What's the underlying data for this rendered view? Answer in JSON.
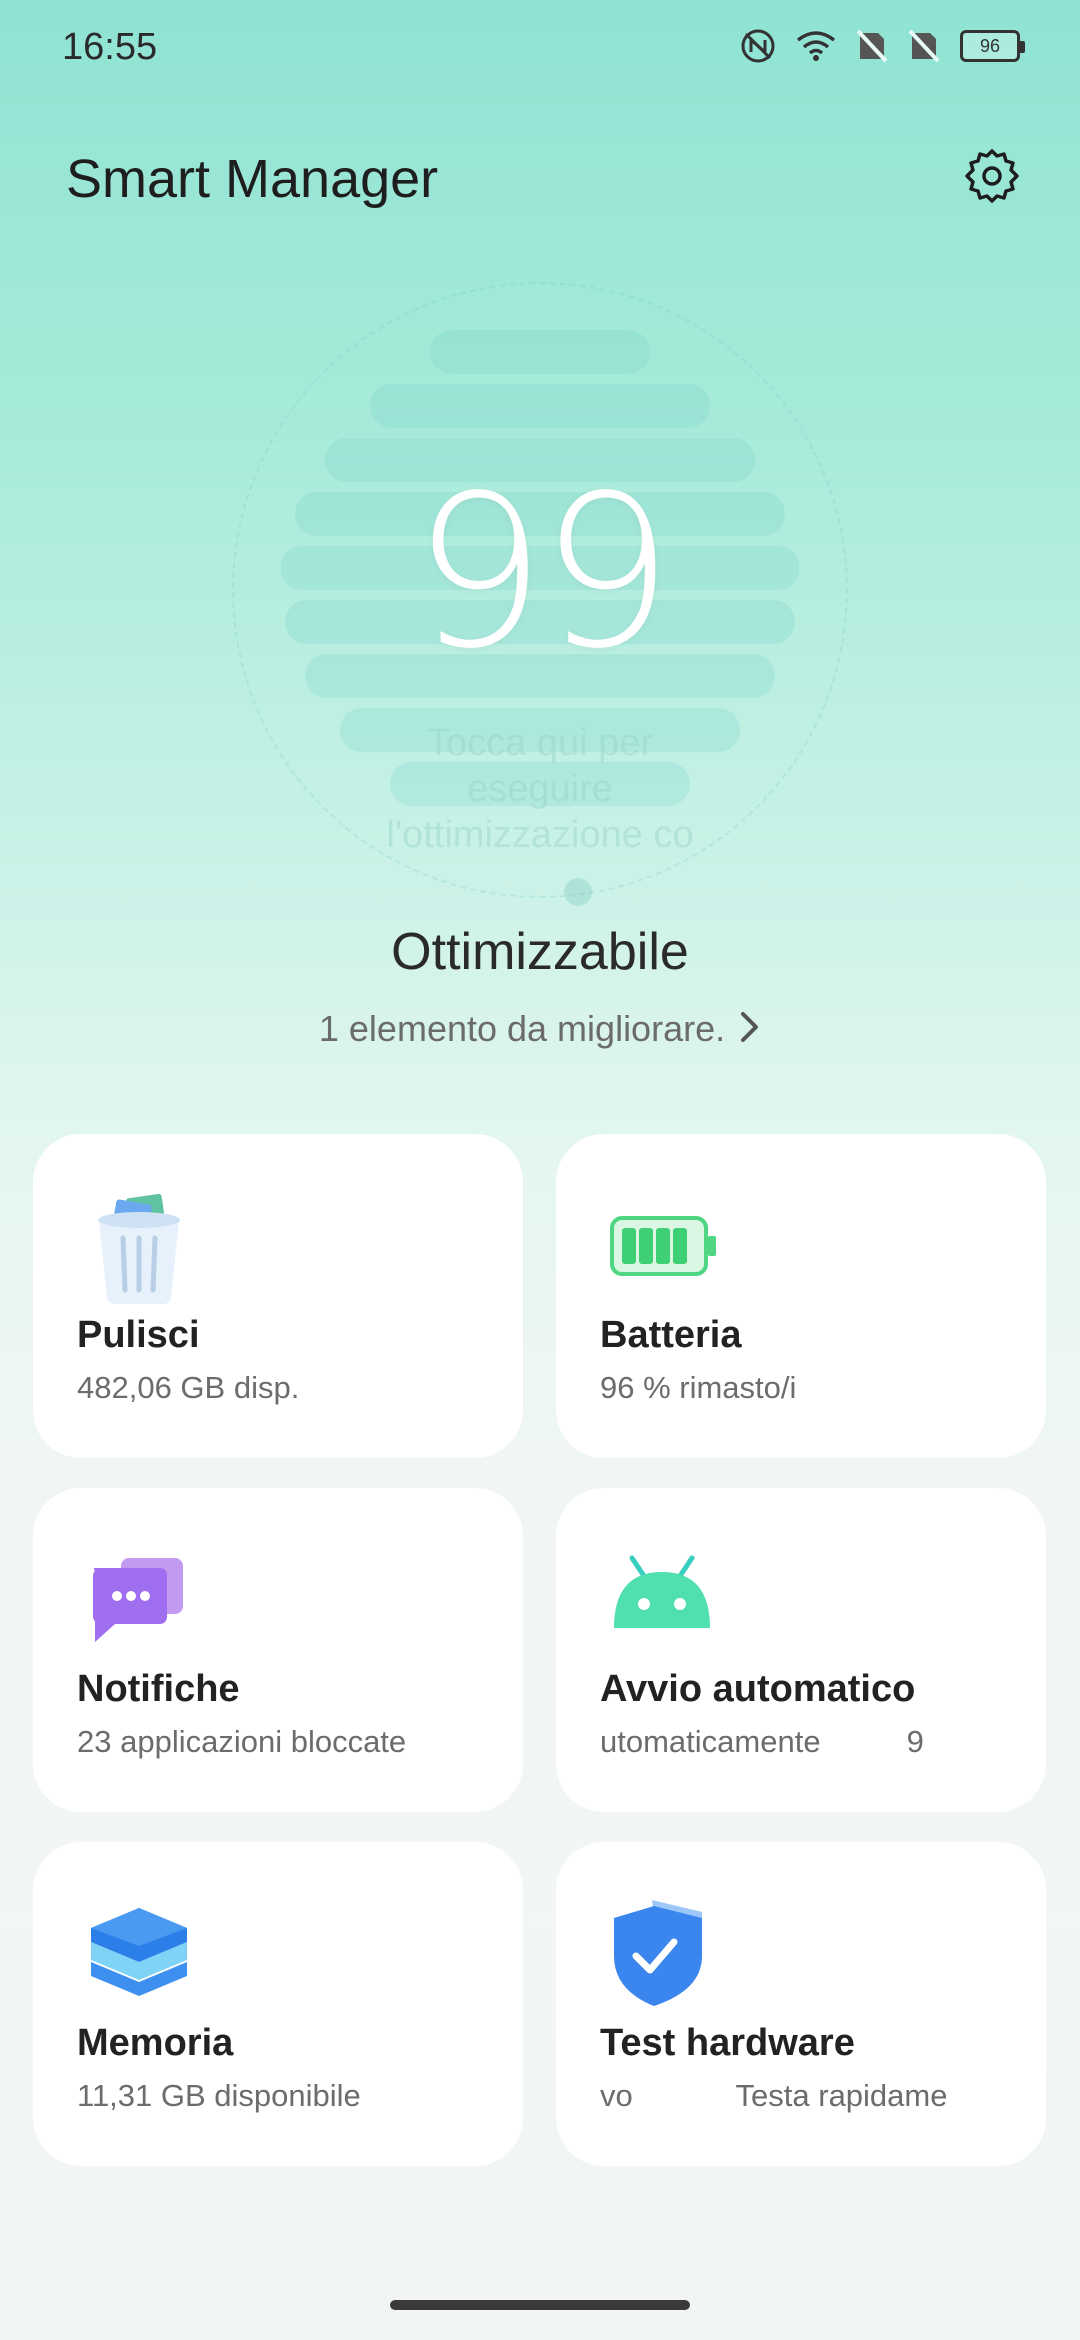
{
  "status_bar": {
    "time": "16:55",
    "battery_level": "96"
  },
  "header": {
    "title": "Smart Manager",
    "settings_icon": "gear-icon"
  },
  "score": {
    "value": "99",
    "tap_hint": "Tocca qui per eseguire l'ottimizzazione co"
  },
  "summary": {
    "title": "Ottimizzabile",
    "subtitle": "1 elemento da migliorare."
  },
  "cards": [
    {
      "icon": "trash-bin-icon",
      "title": "Pulisci",
      "subtitle": "482,06 GB disp."
    },
    {
      "icon": "battery-icon",
      "title": "Batteria",
      "subtitle": "96 % rimasto/i"
    },
    {
      "icon": "chat-bubble-icon",
      "title": "Notifiche",
      "subtitle": "23 applicazioni bloccate"
    },
    {
      "icon": "android-robot-icon",
      "title": "Avvio automatico",
      "subtitle": "utomaticamente          9"
    },
    {
      "icon": "layers-stack-icon",
      "title": "Memoria",
      "subtitle": "11,31 GB disponibile"
    },
    {
      "icon": "shield-check-icon",
      "title": "Test hardware",
      "subtitle": "vo            Testa rapidame"
    }
  ],
  "colors": {
    "accent": "#8fe3d4",
    "card_bg": "#ffffff",
    "battery_green": "#3fcf74"
  }
}
